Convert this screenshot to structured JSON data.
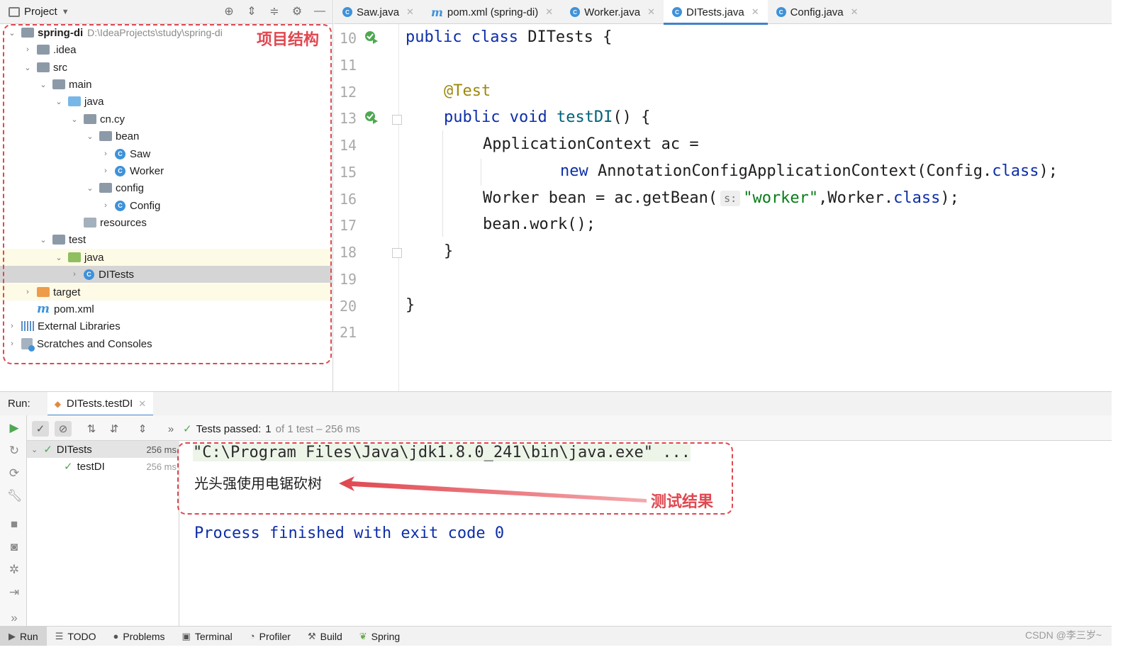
{
  "project_panel": {
    "title": "Project",
    "tree": [
      {
        "label": "spring-di",
        "path": "D:\\IdeaProjects\\study\\spring-di"
      },
      {
        "label": ".idea"
      },
      {
        "label": "src"
      },
      {
        "label": "main"
      },
      {
        "label": "java"
      },
      {
        "label": "cn.cy"
      },
      {
        "label": "bean"
      },
      {
        "label": "Saw"
      },
      {
        "label": "Worker"
      },
      {
        "label": "config"
      },
      {
        "label": "Config"
      },
      {
        "label": "resources"
      },
      {
        "label": "test"
      },
      {
        "label": "java"
      },
      {
        "label": "DITests"
      },
      {
        "label": "target"
      },
      {
        "label": "pom.xml"
      },
      {
        "label": "External Libraries"
      },
      {
        "label": "Scratches and Consoles"
      }
    ],
    "annotation": "项目结构"
  },
  "editor": {
    "tabs": [
      {
        "label": "Saw.java"
      },
      {
        "label": "pom.xml (spring-di)"
      },
      {
        "label": "Worker.java"
      },
      {
        "label": "DITests.java"
      },
      {
        "label": "Config.java"
      }
    ],
    "line_numbers": [
      "10",
      "11",
      "12",
      "13",
      "14",
      "15",
      "16",
      "17",
      "18",
      "19",
      "20",
      "21"
    ],
    "code": {
      "l10_kw": "public class",
      "l10_rest": " DITests {",
      "l12_an": "@Test",
      "l13_kw": "public void",
      "l13_fn": " testDI",
      "l13_rest": "() {",
      "l14": "ApplicationContext ac =",
      "l15_kw": "new",
      "l15_mid": " AnnotationConfigApplicationContext(Config.",
      "l15_kw2": "class",
      "l15_end": ");",
      "l16_pre": "Worker bean = ac.getBean(",
      "l16_hint": "s:",
      "l16_str": "\"worker\"",
      "l16_mid": ",Worker.",
      "l16_kw": "class",
      "l16_end": ");",
      "l17": "bean.work();",
      "l18": "}",
      "l20": "}"
    }
  },
  "run_panel": {
    "label": "Run:",
    "tab": "DITests.testDI",
    "status_prefix": "Tests passed:",
    "status_count": "1",
    "status_rest": "of 1 test – 256 ms",
    "tree": [
      {
        "label": "DITests",
        "time": "256 ms"
      },
      {
        "label": "testDI",
        "time": "256 ms"
      }
    ],
    "console": {
      "cmd": "\"C:\\Program Files\\Java\\jdk1.8.0_241\\bin\\java.exe\" ...",
      "output": "光头强使用电锯砍树",
      "exit": "Process finished with exit code 0"
    },
    "annotation": "测试结果"
  },
  "bottom_bar": {
    "items": [
      "Run",
      "TODO",
      "Problems",
      "Terminal",
      "Profiler",
      "Build",
      "Spring"
    ]
  },
  "watermark": "CSDN @李三岁~",
  "colors": {
    "keyword": "#0d2ea8",
    "annotation": "#9e880d",
    "string": "#067d17",
    "accent": "#4083c9",
    "highlight_red": "#e0474f"
  }
}
